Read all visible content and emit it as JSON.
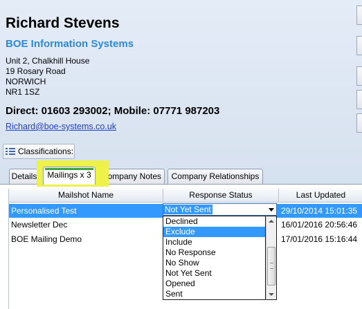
{
  "contact": {
    "name": "Richard Stevens",
    "company": "BOE Information Systems",
    "address": [
      "Unit 2, Chalkhill House",
      "19 Rosary Road",
      "NORWICH",
      "NR1 1SZ"
    ],
    "phones": "Direct: 01603 293002; Mobile: 07771 987203",
    "email": "Richard@boe-systems.co.uk",
    "company_color": "#2a8ad8"
  },
  "classifications": {
    "label": "Classifications:",
    "icon": "list-icon"
  },
  "tabs": [
    {
      "label": "Details"
    },
    {
      "label": "Mailings x 3"
    },
    {
      "label": "Company Notes"
    },
    {
      "label": "Company Relationships"
    }
  ],
  "grid": {
    "columns": [
      "Mailshot Name",
      "Response Status",
      "Last Updated"
    ],
    "rows": [
      {
        "name": "Personalised Test",
        "status": "Not Yet Sent",
        "updated": "29/10/2014 15:01:35"
      },
      {
        "name": "Newsletter Dec",
        "status": "",
        "updated": "16/01/2016 20:56:46"
      },
      {
        "name": "BOE Mailing Demo",
        "status": "",
        "updated": "17/01/2016 15:16:44"
      }
    ]
  },
  "dropdown": {
    "selected": "Not Yet Sent",
    "highlighted": "Exclude",
    "options": [
      "Declined",
      "Exclude",
      "Include",
      "No Response",
      "No Show",
      "Not Yet Sent",
      "Opened",
      "Sent"
    ]
  },
  "colors": {
    "selection": "#3399ff",
    "tab_highlight": "#eef14a",
    "active_tab_accent": "#3f9f43"
  }
}
